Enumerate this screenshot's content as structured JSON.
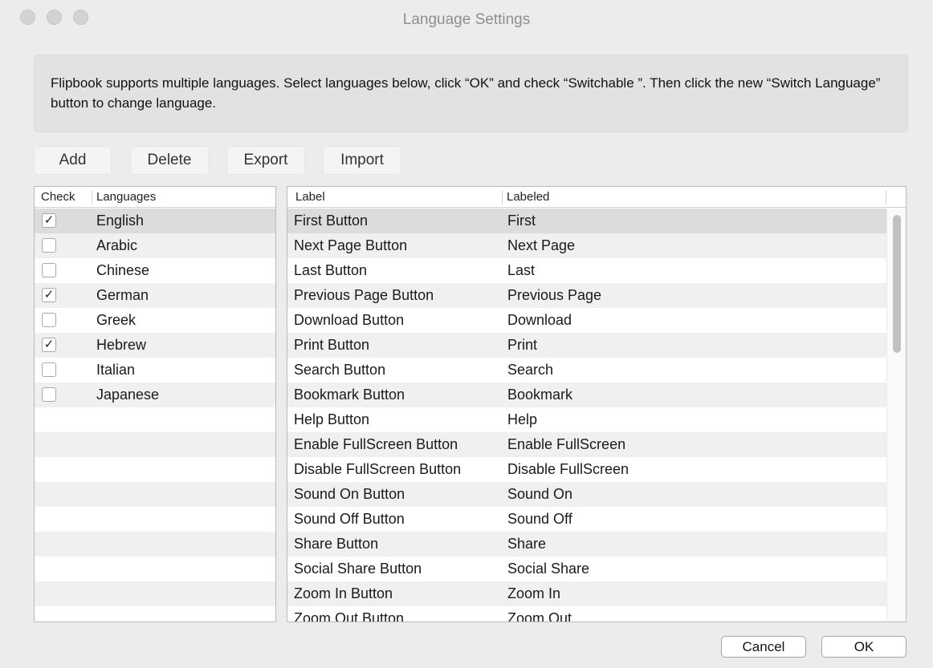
{
  "window": {
    "title": "Language Settings"
  },
  "info": {
    "text": "Flipbook supports multiple languages. Select languages below, click  “OK” and check “Switchable ”. Then click the new “Switch Language” button to change language."
  },
  "toolbar": {
    "add": "Add",
    "delete": "Delete",
    "export": "Export",
    "import": "Import"
  },
  "languages": {
    "headers": {
      "check": "Check",
      "languages": "Languages"
    },
    "rows": [
      {
        "name": "English",
        "checked": true
      },
      {
        "name": "Arabic",
        "checked": false
      },
      {
        "name": "Chinese",
        "checked": false
      },
      {
        "name": "German",
        "checked": true
      },
      {
        "name": "Greek",
        "checked": false
      },
      {
        "name": "Hebrew",
        "checked": true
      },
      {
        "name": "Italian",
        "checked": false
      },
      {
        "name": "Japanese",
        "checked": false
      }
    ],
    "check_mark": "✓"
  },
  "labels": {
    "headers": {
      "label": "Label",
      "labeled": "Labeled"
    },
    "rows": [
      {
        "label": "First Button",
        "labeled": "First"
      },
      {
        "label": "Next Page Button",
        "labeled": "Next Page"
      },
      {
        "label": "Last Button",
        "labeled": "Last"
      },
      {
        "label": "Previous Page Button",
        "labeled": "Previous Page"
      },
      {
        "label": "Download Button",
        "labeled": "Download"
      },
      {
        "label": "Print Button",
        "labeled": "Print"
      },
      {
        "label": "Search Button",
        "labeled": "Search"
      },
      {
        "label": "Bookmark Button",
        "labeled": "Bookmark"
      },
      {
        "label": "Help Button",
        "labeled": "Help"
      },
      {
        "label": "Enable FullScreen Button",
        "labeled": "Enable FullScreen"
      },
      {
        "label": "Disable FullScreen Button",
        "labeled": "Disable FullScreen"
      },
      {
        "label": "Sound On Button",
        "labeled": "Sound On"
      },
      {
        "label": "Sound Off Button",
        "labeled": "Sound Off"
      },
      {
        "label": "Share Button",
        "labeled": "Share"
      },
      {
        "label": "Social Share Button",
        "labeled": "Social Share"
      },
      {
        "label": "Zoom In Button",
        "labeled": "Zoom In"
      },
      {
        "label": "Zoom Out Button",
        "labeled": "Zoom Out"
      }
    ]
  },
  "footer": {
    "cancel": "Cancel",
    "ok": "OK"
  }
}
